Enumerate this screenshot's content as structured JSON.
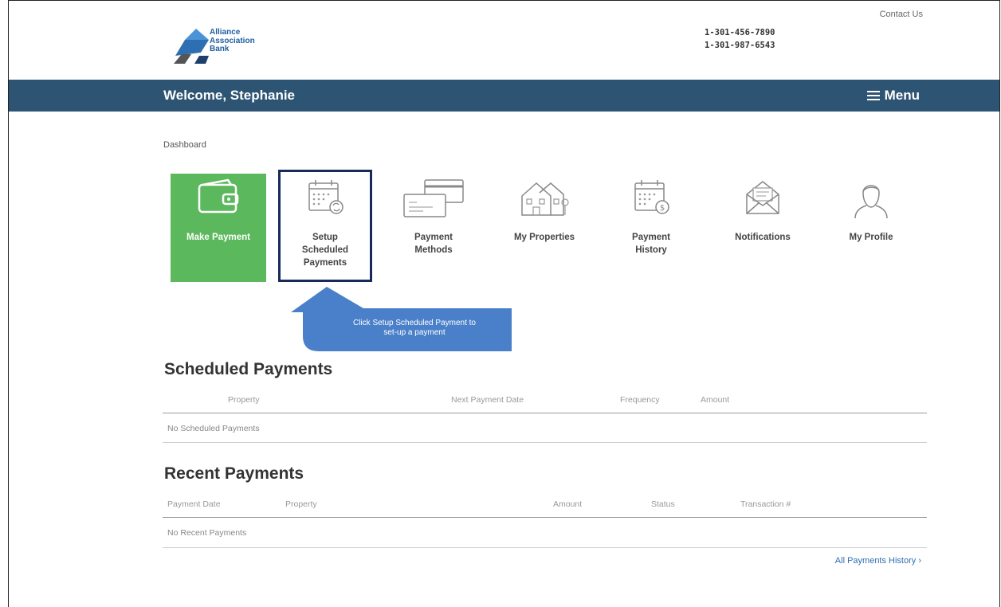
{
  "header": {
    "contact_label": "Contact Us",
    "phone_1": "1-301-456-7890",
    "phone_2": "1-301-987-6543",
    "logo_lines": [
      "Alliance",
      "Association",
      "Bank"
    ]
  },
  "navbar": {
    "welcome": "Welcome, Stephanie",
    "menu_label": "Menu"
  },
  "breadcrumb": "Dashboard",
  "tiles": [
    {
      "lines": [
        "Make Payment"
      ],
      "icon": "wallet-icon"
    },
    {
      "lines": [
        "Setup",
        "Scheduled",
        "Payments"
      ],
      "icon": "calendar-refresh-icon"
    },
    {
      "lines": [
        "Payment",
        "Methods"
      ],
      "icon": "credit-card-icon"
    },
    {
      "lines": [
        "My Properties"
      ],
      "icon": "houses-icon"
    },
    {
      "lines": [
        "Payment",
        "History"
      ],
      "icon": "calendar-dollar-icon"
    },
    {
      "lines": [
        "Notifications"
      ],
      "icon": "envelope-icon"
    },
    {
      "lines": [
        "My Profile"
      ],
      "icon": "user-icon"
    }
  ],
  "callout": {
    "lines": [
      "Click Setup Scheduled Payment to",
      "set-up a payment"
    ]
  },
  "scheduled": {
    "title": "Scheduled Payments",
    "columns": [
      "Property",
      "Next Payment Date",
      "Frequency",
      "Amount"
    ],
    "empty": "No Scheduled Payments"
  },
  "recent": {
    "title": "Recent Payments",
    "columns": [
      "Payment Date",
      "Property",
      "Amount",
      "Status",
      "Transaction #"
    ],
    "empty": "No Recent Payments"
  },
  "all_history_link": "All Payments History ›",
  "colors": {
    "navbar": "#2e5474",
    "primary_tile": "#5cb85c",
    "callout": "#4a80c9",
    "highlight": "#172a5a"
  }
}
